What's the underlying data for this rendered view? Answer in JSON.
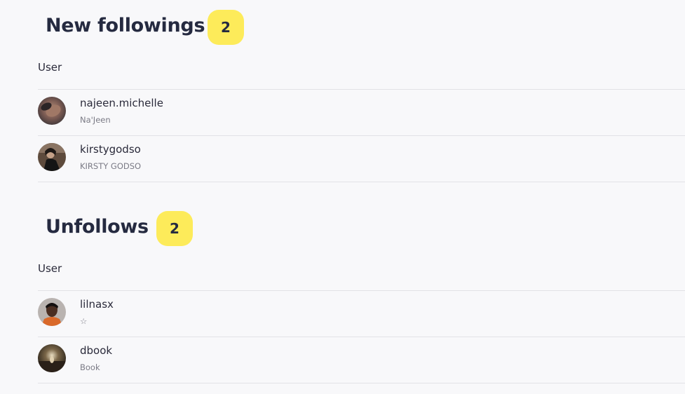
{
  "sections": [
    {
      "title": "New followings",
      "count": "2",
      "column_header": "User",
      "users": [
        {
          "username": "najeen.michelle",
          "fullname": "Na'Jeen",
          "avatar_icon": "user-avatar-photo"
        },
        {
          "username": "kirstygodso",
          "fullname": "KIRSTY GODSO",
          "avatar_icon": "user-avatar-photo"
        }
      ]
    },
    {
      "title": "Unfollows",
      "count": "2",
      "column_header": "User",
      "users": [
        {
          "username": "lilnasx",
          "fullname": "☆",
          "avatar_icon": "user-avatar-photo"
        },
        {
          "username": "dbook",
          "fullname": "Book",
          "avatar_icon": "user-avatar-photo"
        }
      ]
    }
  ],
  "colors": {
    "background": "#f8f8fa",
    "badge": "#fdeb5a",
    "title": "#252a40",
    "secondary_text": "#7a7a85",
    "divider": "#e2e2e6"
  }
}
